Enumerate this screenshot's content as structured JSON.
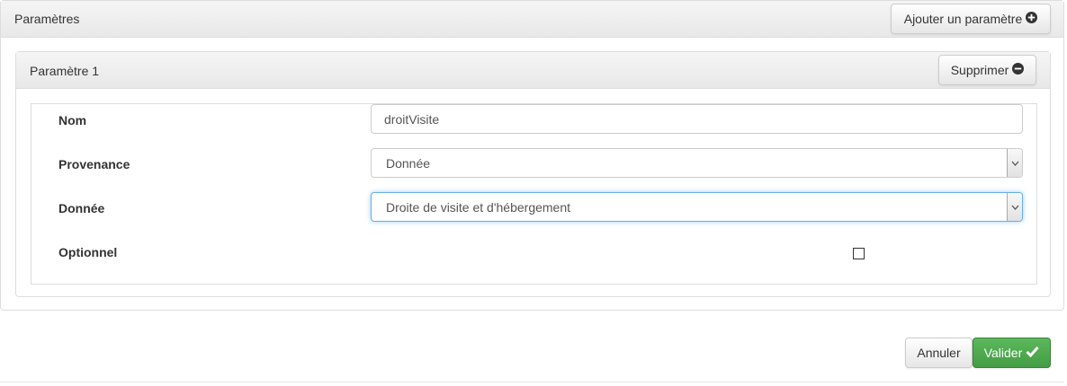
{
  "panel": {
    "title": "Paramètres",
    "add_button_label": "Ajouter un paramètre"
  },
  "parameter": {
    "title": "Paramètre 1",
    "delete_button_label": "Supprimer",
    "fields": {
      "nom_label": "Nom",
      "nom_value": "droitVisite",
      "provenance_label": "Provenance",
      "provenance_value": "Donnée",
      "donnee_label": "Donnée",
      "donnee_value": "Droite de visite et d'hébergement",
      "optionnel_label": "Optionnel",
      "optionnel_checked": false
    }
  },
  "footer": {
    "cancel_label": "Annuler",
    "submit_label": "Valider"
  },
  "icons": {
    "add": "plus-circle-icon",
    "remove": "minus-circle-icon",
    "submit": "check-icon",
    "select_arrow": "chevron-down-icon"
  },
  "colors": {
    "submit_green": "#5cb85c",
    "focus_blue": "#66afe9"
  }
}
